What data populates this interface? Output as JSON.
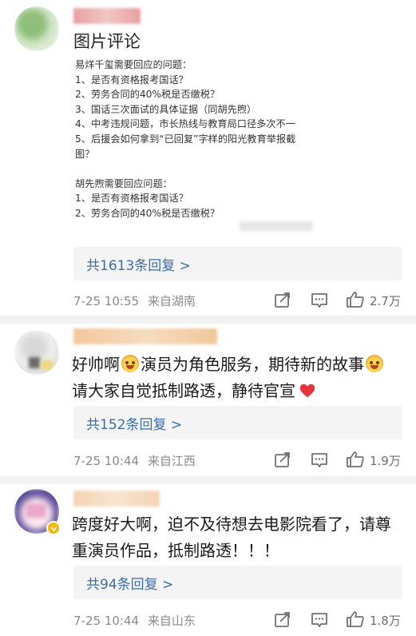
{
  "comments": [
    {
      "image_title": "图片评论",
      "image_text": "易烊千玺需要回应的问题：\n1、是否有资格报考国话？\n2、劳务合同的40%税是否缴税？\n3、国话三次面试的具体证据（同胡先煦）\n4、中考违规问题，市长热线与教育局口径多次不一\n5、后援会如何拿到“已回复”字样的阳光教育举报截图？\n\n胡先煦需要回应问题：\n1、是否有资格报考国话？\n2、劳务合同的40%税是否缴税？",
      "reply_label": "共1613条回复 >",
      "time": "7-25 10:55",
      "location": "来自湖南",
      "likes": "2.7万"
    },
    {
      "text_part1": "好帅啊",
      "text_part2": "演员为角色服务，期待新的故事",
      "text_part3": "请大家自觉抵制路透，静待官宣",
      "reply_label": "共152条回复 >",
      "time": "7-25 10:44",
      "location": "来自江西",
      "likes": "1.9万"
    },
    {
      "text": "跨度好大啊，迫不及待想去电影院看了，请尊重演员作品，抵制路透！！！",
      "reply_label": "共94条回复 >",
      "time": "7-25 10:44",
      "location": "来自山东",
      "likes": "1.8万"
    }
  ],
  "icons": [
    "share-icon",
    "comment-icon",
    "like-icon",
    "emoji-icon",
    "heart-icon"
  ],
  "colors": {
    "link": "#3e6da5",
    "meta": "#8a8a8a",
    "reply_bg": "#f4f4f4",
    "heart": "#e8333a"
  }
}
